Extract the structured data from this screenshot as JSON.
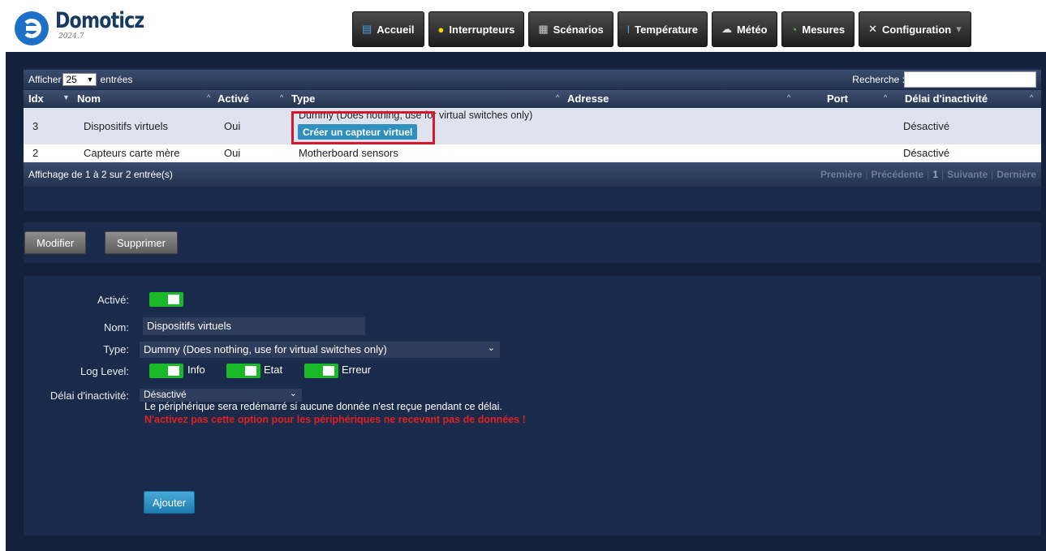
{
  "app": {
    "name": "Domoticz",
    "version": "2024.7"
  },
  "nav": [
    {
      "label": "Accueil",
      "icon": "home-icon",
      "glyph": "▤",
      "color": "#4aa3df"
    },
    {
      "label": "Interrupteurs",
      "icon": "bulb-icon",
      "glyph": "💡",
      "color": "#f5d800"
    },
    {
      "label": "Scénarios",
      "icon": "clapper-icon",
      "glyph": "🎬",
      "color": "#cccccc"
    },
    {
      "label": "Température",
      "icon": "thermometer-icon",
      "glyph": "🌡",
      "color": "#5aa0e8"
    },
    {
      "label": "Météo",
      "icon": "cloud-icon",
      "glyph": "☁",
      "color": "#dddddd"
    },
    {
      "label": "Mesures",
      "icon": "gauge-icon",
      "glyph": "◔",
      "color": "#6ab04c"
    },
    {
      "label": "Configuration",
      "icon": "tools-icon",
      "glyph": "✕",
      "color": "#ffffff",
      "caret": "▾"
    }
  ],
  "table": {
    "show_label": "Afficher",
    "show_value": "25",
    "entries_label": "entrées",
    "search_label": "Recherche :",
    "columns": [
      "Idx",
      "Nom",
      "Activé",
      "Type",
      "Adresse",
      "Port",
      "Délai d'inactivité"
    ],
    "rows": [
      {
        "idx": "3",
        "name": "Dispositifs virtuels",
        "enabled": "Oui",
        "type": "Dummy (Does nothing, use for virtual switches only)",
        "address": "",
        "port": "",
        "timeout": "Désactivé",
        "action": "Créer un capteur virtuel"
      },
      {
        "idx": "2",
        "name": "Capteurs carte mère",
        "enabled": "Oui",
        "type": "Motherboard sensors",
        "address": "",
        "port": "",
        "timeout": "Désactivé"
      }
    ],
    "footer_info": "Affichage de 1 à 2 sur 2 entrée(s)",
    "pager": {
      "first": "Première",
      "previous": "Précédente",
      "page": "1",
      "next": "Suivante",
      "last": "Dernière"
    }
  },
  "actions": {
    "modify": "Modifier",
    "delete": "Supprimer"
  },
  "form": {
    "enabled_label": "Activé:",
    "name_label": "Nom:",
    "name_value": "Dispositifs virtuels",
    "type_label": "Type:",
    "type_value": "Dummy (Does nothing, use for virtual switches only)",
    "loglevel_label": "Log Level:",
    "log_info": "Info",
    "log_status": "Etat",
    "log_error": "Erreur",
    "timeout_label": "Délai d'inactivité:",
    "timeout_value": "Désactivé",
    "timeout_note": "Le périphérique sera redémarré si aucune donnée n'est reçue pendant ce délai.",
    "timeout_warning": "N'activez pas cette option pour les périphériques ne recevant pas de données !",
    "add_button": "Ajouter"
  },
  "colors": {
    "accent": "#2f8fbf",
    "toggle_on": "#18b829",
    "highlight": "#d7182a",
    "warning": "#e02020"
  }
}
